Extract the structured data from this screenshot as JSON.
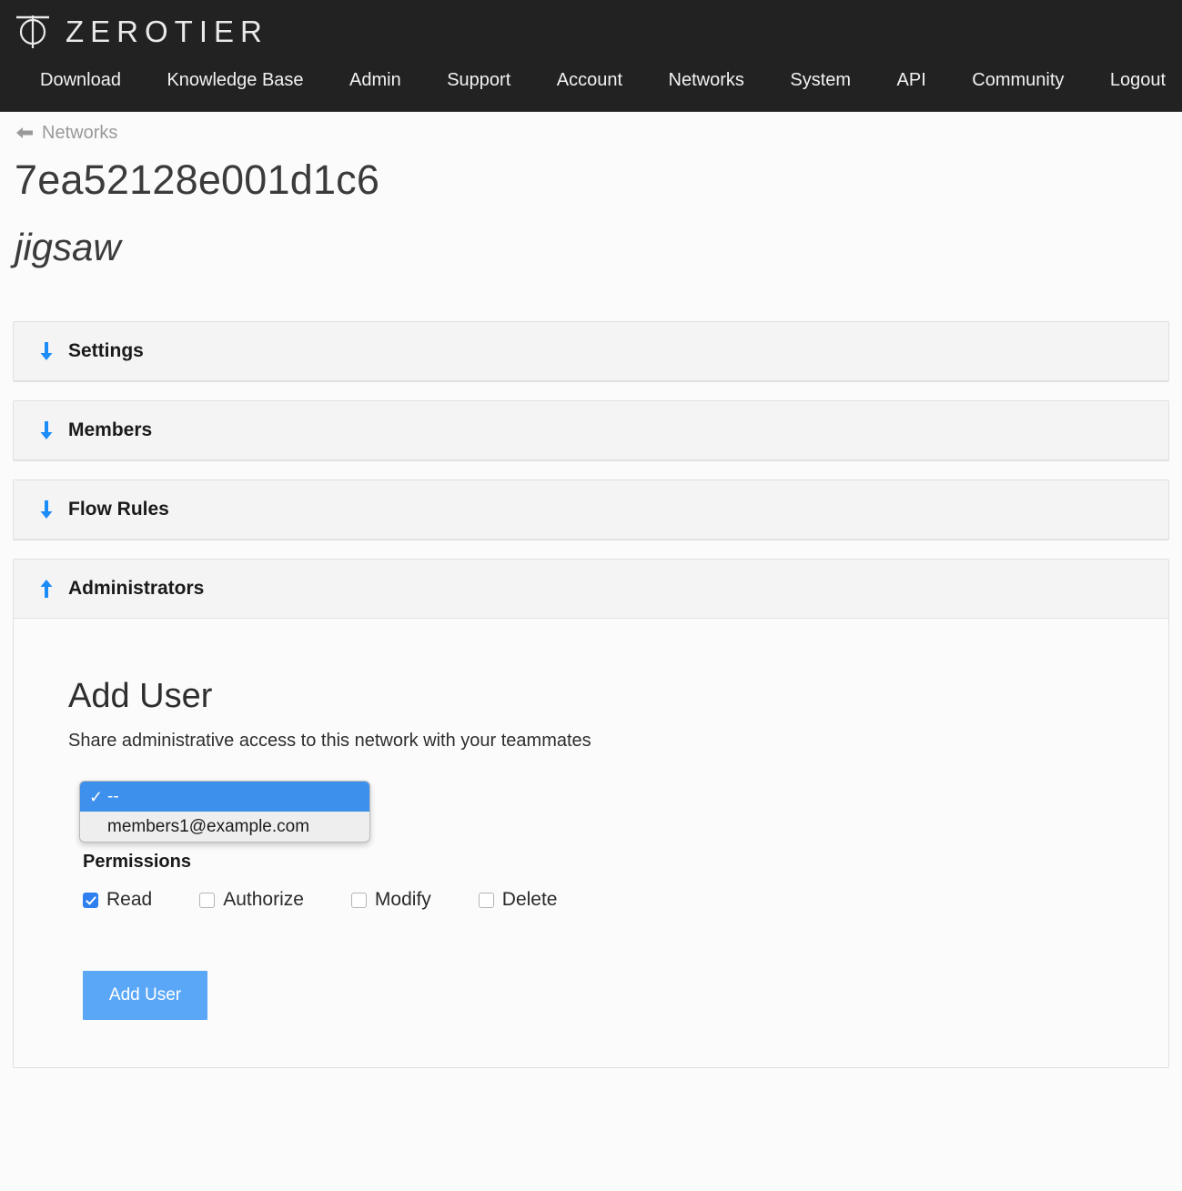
{
  "brand": {
    "name": "ZEROTIER",
    "logo_icon": "zerotier-phi-logo"
  },
  "nav": {
    "items": [
      {
        "label": "Download"
      },
      {
        "label": "Knowledge Base"
      },
      {
        "label": "Admin"
      },
      {
        "label": "Support"
      },
      {
        "label": "Account"
      },
      {
        "label": "Networks"
      },
      {
        "label": "System"
      },
      {
        "label": "API"
      },
      {
        "label": "Community"
      },
      {
        "label": "Logout"
      }
    ]
  },
  "breadcrumb": {
    "back_icon": "arrow-left-icon",
    "label": "Networks"
  },
  "page": {
    "network_id": "7ea52128e001d1c6",
    "network_name": "jigsaw"
  },
  "sections": [
    {
      "title": "Settings",
      "arrow_icon": "arrow-down-icon",
      "expanded": false
    },
    {
      "title": "Members",
      "arrow_icon": "arrow-down-icon",
      "expanded": false
    },
    {
      "title": "Flow Rules",
      "arrow_icon": "arrow-down-icon",
      "expanded": false
    },
    {
      "title": "Administrators",
      "arrow_icon": "arrow-up-icon",
      "expanded": true
    }
  ],
  "add_user": {
    "heading": "Add User",
    "description": "Share administrative access to this network with your teammates",
    "user_select": {
      "open": true,
      "selected_value": "--",
      "options": [
        {
          "label": "--",
          "selected": true
        },
        {
          "label": "members1@example.com",
          "selected": false
        }
      ]
    },
    "permissions_label": "Permissions",
    "permissions": [
      {
        "label": "Read",
        "checked": true
      },
      {
        "label": "Authorize",
        "checked": false
      },
      {
        "label": "Modify",
        "checked": false
      },
      {
        "label": "Delete",
        "checked": false
      }
    ],
    "submit_label": "Add User"
  },
  "colors": {
    "navbar_bg": "#222222",
    "accent_blue": "#2f7ff0",
    "button_blue": "#5ba7f7",
    "select_highlight": "#3d90ec",
    "panel_header_bg": "#f4f4f4",
    "page_bg": "#fbfbfb"
  }
}
